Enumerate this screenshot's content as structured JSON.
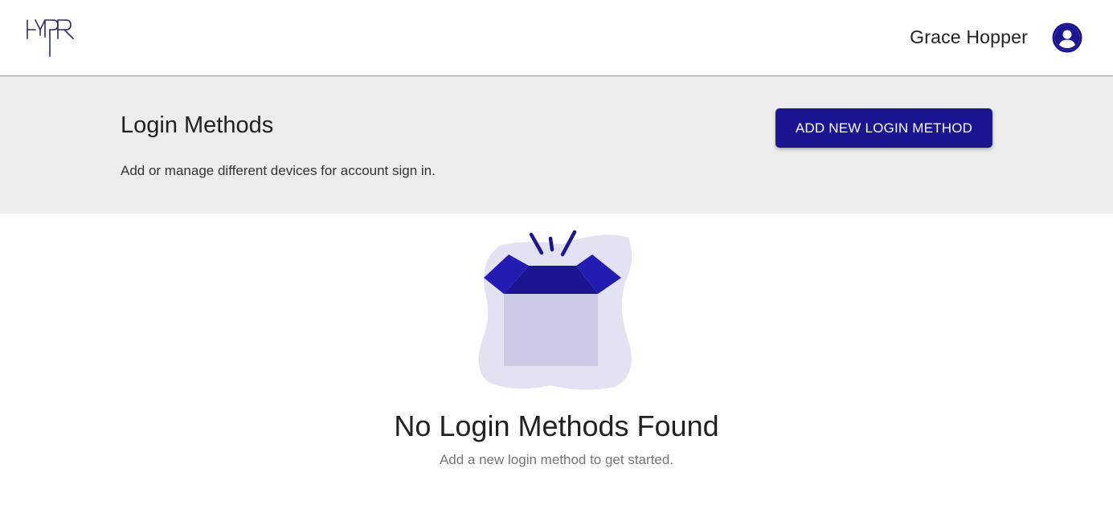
{
  "header": {
    "logo_text": "HYPR",
    "user_name": "Grace Hopper",
    "avatar_icon": "account-circle-icon"
  },
  "page": {
    "title": "Login Methods",
    "subtitle": "Add or manage different devices for account sign in.",
    "add_button_label": "ADD NEW LOGIN METHOD"
  },
  "empty_state": {
    "illustration_icon": "open-box-icon",
    "title": "No Login Methods Found",
    "subtitle": "Add a new login method to get started."
  },
  "colors": {
    "brand": "#1a1590",
    "band_background": "#ededed",
    "blob": "#e3e2f2",
    "box_body": "#cccbe6",
    "box_flap": "#231cb3"
  }
}
